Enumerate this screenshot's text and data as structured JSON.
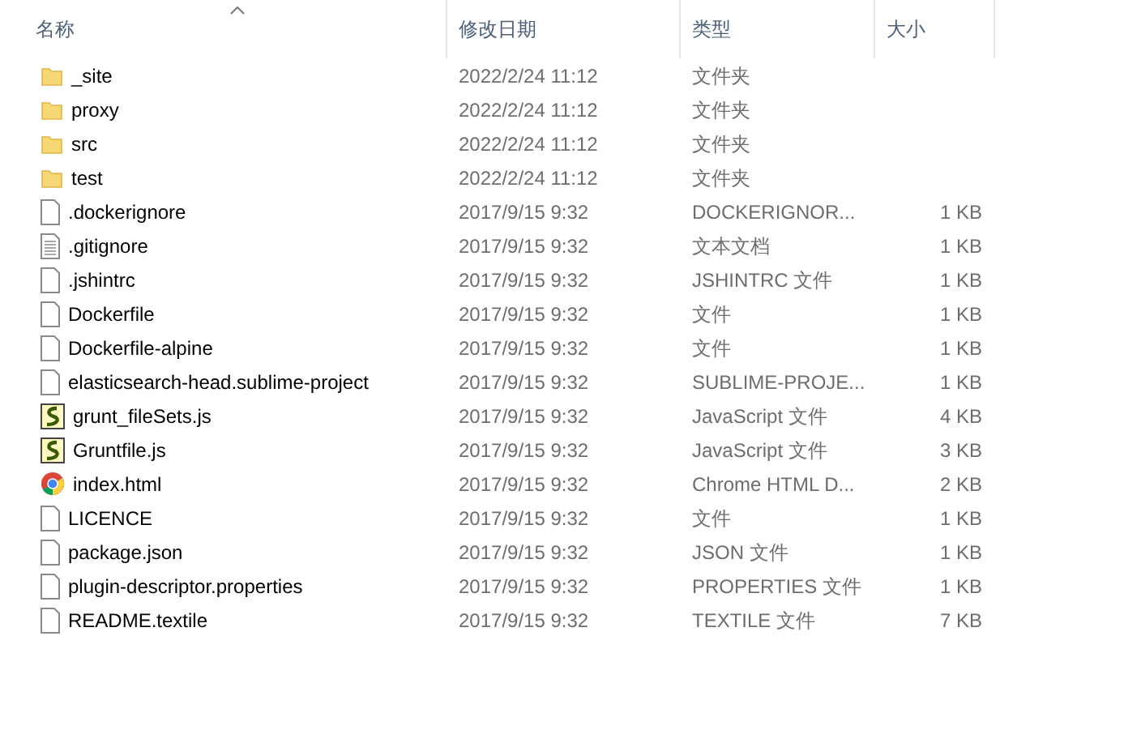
{
  "columns": [
    {
      "label": "名称",
      "sorted": true
    },
    {
      "label": "修改日期",
      "sorted": false
    },
    {
      "label": "类型",
      "sorted": false
    },
    {
      "label": "大小",
      "sorted": false
    }
  ],
  "rows": [
    {
      "kind": "folder",
      "name": "_site",
      "date": "2022/2/24 11:12",
      "type": "文件夹"
    },
    {
      "kind": "folder",
      "name": "proxy",
      "date": "2022/2/24 11:12",
      "type": "文件夹"
    },
    {
      "kind": "folder",
      "name": "src",
      "date": "2022/2/24 11:12",
      "type": "文件夹"
    },
    {
      "kind": "folder",
      "name": "test",
      "date": "2022/2/24 11:12",
      "type": "文件夹"
    },
    {
      "kind": "file",
      "name": ".dockerignore",
      "date": "2017/9/15 9:32",
      "type": "DOCKERIGNOR...",
      "size": "1 KB"
    },
    {
      "kind": "text",
      "name": ".gitignore",
      "date": "2017/9/15 9:32",
      "type": "文本文档",
      "size": "1 KB"
    },
    {
      "kind": "file",
      "name": ".jshintrc",
      "date": "2017/9/15 9:32",
      "type": "JSHINTRC 文件",
      "size": "1 KB"
    },
    {
      "kind": "file",
      "name": "Dockerfile",
      "date": "2017/9/15 9:32",
      "type": "文件",
      "size": "1 KB"
    },
    {
      "kind": "file",
      "name": "Dockerfile-alpine",
      "date": "2017/9/15 9:32",
      "type": "文件",
      "size": "1 KB"
    },
    {
      "kind": "file",
      "name": "elasticsearch-head.sublime-project",
      "date": "2017/9/15 9:32",
      "type": "SUBLIME-PROJE...",
      "size": "1 KB"
    },
    {
      "kind": "script",
      "name": "grunt_fileSets.js",
      "date": "2017/9/15 9:32",
      "type": "JavaScript 文件",
      "size": "4 KB"
    },
    {
      "kind": "script",
      "name": "Gruntfile.js",
      "date": "2017/9/15 9:32",
      "type": "JavaScript 文件",
      "size": "3 KB"
    },
    {
      "kind": "chrome",
      "name": "index.html",
      "date": "2017/9/15 9:32",
      "type": "Chrome HTML D...",
      "size": "2 KB"
    },
    {
      "kind": "file",
      "name": "LICENCE",
      "date": "2017/9/15 9:32",
      "type": "文件",
      "size": "1 KB"
    },
    {
      "kind": "file",
      "name": "package.json",
      "date": "2017/9/15 9:32",
      "type": "JSON 文件",
      "size": "1 KB"
    },
    {
      "kind": "file",
      "name": "plugin-descriptor.properties",
      "date": "2017/9/15 9:32",
      "type": "PROPERTIES 文件",
      "size": "1 KB"
    },
    {
      "kind": "file",
      "name": "README.textile",
      "date": "2017/9/15 9:32",
      "type": "TEXTILE 文件",
      "size": "7 KB"
    }
  ]
}
